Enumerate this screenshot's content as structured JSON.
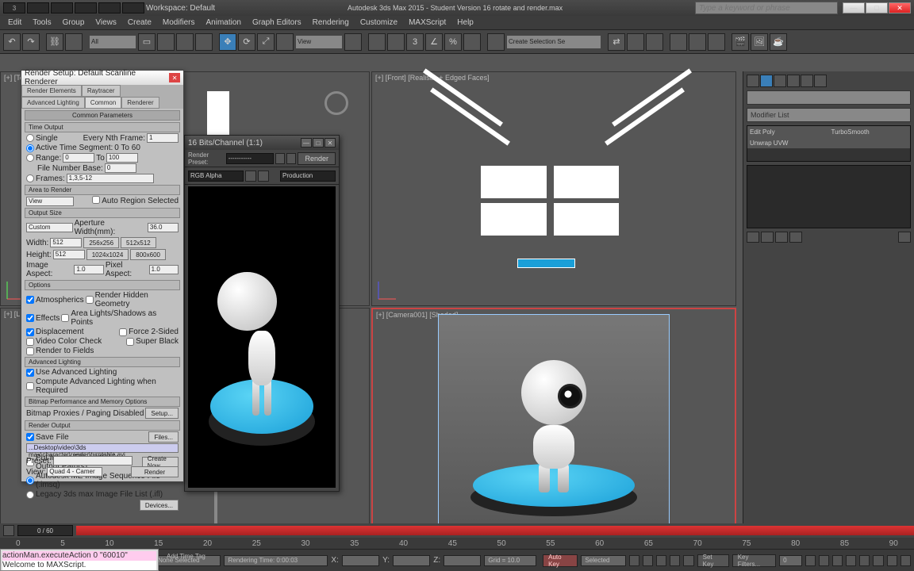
{
  "app": {
    "title": "Autodesk 3ds Max 2015 - Student Version   16 rotate and render.max",
    "search_placeholder": "Type a keyword or phrase",
    "workspace": "Workspace: Default"
  },
  "menu": [
    "Edit",
    "Tools",
    "Group",
    "Views",
    "Create",
    "Modifiers",
    "Animation",
    "Graph Editors",
    "Rendering",
    "Customize",
    "MAXScript",
    "Help"
  ],
  "toolbar": {
    "filter": "All",
    "view": "View",
    "selset": "Create Selection Se"
  },
  "viewports": {
    "tl": "[+] [Top] [Realistic + Edged Faces]",
    "tr": "[+] [Front] [Realistic + Edged Faces]",
    "bl": "[+] [L...",
    "br": "[+] [Camera001] [Shaded]"
  },
  "cmdpanel": {
    "modifier_list": "Modifier List",
    "stack": [
      [
        "Edit Poly",
        "TurboSmooth"
      ],
      [
        "Unwrap UVW",
        ""
      ]
    ]
  },
  "timeline": {
    "frame": "0 / 60",
    "ticks": [
      0,
      5,
      10,
      15,
      20,
      25,
      30,
      35,
      40,
      45,
      50,
      55,
      60,
      65,
      70,
      75,
      80,
      85,
      90
    ]
  },
  "status": {
    "script1": "actionMan.executeAction 0 \"60010\"",
    "script2": "Welcome to MAXScript.",
    "sel": "None Selected",
    "render_time": "Rendering Time: 0:00:03",
    "x": "X:",
    "y": "Y:",
    "z": "Z:",
    "grid": "Grid = 10.0",
    "autokey": "Auto Key",
    "setkey": "Set Key",
    "keymode": "Selected",
    "keyfilters": "Key Filters...",
    "addtime": "Add Time Tag"
  },
  "render_setup": {
    "title": "Render Setup: Default Scanline Renderer",
    "tabs": [
      "Render Elements",
      "Raytracer",
      "Advanced Lighting",
      "Common",
      "Renderer"
    ],
    "common_params": "Common Parameters",
    "time_output": "Time Output",
    "single": "Single",
    "every_nth": "Every Nth Frame:",
    "every_nth_val": "1",
    "active_seg": "Active Time Segment:",
    "active_val": "0 To 60",
    "range": "Range:",
    "range_a": "0",
    "range_to": "To",
    "range_b": "100",
    "file_num_base": "File Number Base:",
    "file_num_val": "0",
    "frames": "Frames:",
    "frames_val": "1,3,5-12",
    "area": "Area to Render",
    "area_mode": "View",
    "auto_region": "Auto Region Selected",
    "output_size": "Output Size",
    "os_mode": "Custom",
    "aperture": "Aperture Width(mm):",
    "aperture_val": "36.0",
    "width": "Width:",
    "width_val": "512",
    "height": "Height:",
    "height_val": "512",
    "btn_256": "256x256",
    "btn_512": "512x512",
    "btn_1024": "1024x1024",
    "btn_800": "800x600",
    "img_aspect": "Image Aspect:",
    "img_aspect_val": "1.0",
    "pix_aspect": "Pixel Aspect:",
    "pix_aspect_val": "1.0",
    "options": "Options",
    "atmospherics": "Atmospherics",
    "render_hidden": "Render Hidden Geometry",
    "effects": "Effects",
    "area_lights": "Area Lights/Shadows as Points",
    "displacement": "Displacement",
    "force2": "Force 2-Sided",
    "video_color": "Video Color Check",
    "super_black": "Super Black",
    "render_fields": "Render to Fields",
    "adv_lighting": "Advanced Lighting",
    "use_adv": "Use Advanced Lighting",
    "compute_adv": "Compute Advanced Lighting when Required",
    "bitmap_perf": "Bitmap Performance and Memory Options",
    "bitmap_proxies": "Bitmap Proxies / Paging Disabled",
    "setup_btn": "Setup...",
    "render_output": "Render Output",
    "save_file": "Save File",
    "files_btn": "Files...",
    "save_path": "...Desktop\\video\\3ds max\\character\\render\\turntable.avi",
    "put_image": "Put Image File List(s) in Output Path(s)",
    "create_now": "Create Now",
    "autodesk_me": "Autodesk ME Image Sequence File (.imsq)",
    "legacy": "Legacy 3ds max Image File List (.ifl)",
    "devices": "Devices...",
    "preset": "Preset:",
    "view_label": "View:",
    "view_val": "Quad 4 - Camer",
    "render_btn": "Render"
  },
  "render_frame": {
    "title": "16 Bits/Channel (1:1)",
    "preset_lbl": "Render Preset:",
    "render_btn": "Render",
    "mode": "Production",
    "channel": "RGB Alpha"
  }
}
